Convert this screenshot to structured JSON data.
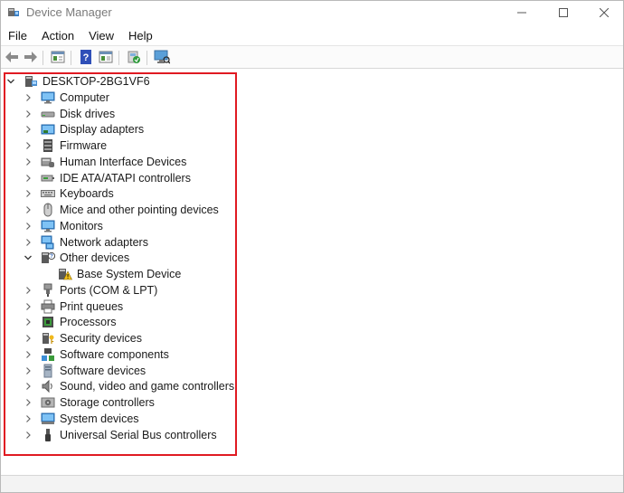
{
  "window": {
    "title": "Device Manager",
    "icon": "device-manager-icon",
    "controls": [
      "minimize-icon",
      "maximize-icon",
      "close-icon"
    ]
  },
  "menubar": {
    "items": [
      "File",
      "Action",
      "View",
      "Help"
    ]
  },
  "toolbar": {
    "buttons": [
      "back-arrow-icon",
      "forward-arrow-icon",
      "properties-icon",
      "help-icon",
      "show-hide-icon",
      "update-driver-icon",
      "scan-hardware-icon"
    ]
  },
  "tree": {
    "root": {
      "label": "DESKTOP-2BG1VF6",
      "expanded": true,
      "icon": "computer-tower-icon"
    },
    "categories": [
      {
        "label": "Computer",
        "icon": "monitor-icon",
        "expanded": false
      },
      {
        "label": "Disk drives",
        "icon": "disk-drive-icon",
        "expanded": false
      },
      {
        "label": "Display adapters",
        "icon": "display-adapter-icon",
        "expanded": false
      },
      {
        "label": "Firmware",
        "icon": "firmware-icon",
        "expanded": false
      },
      {
        "label": "Human Interface Devices",
        "icon": "hid-icon",
        "expanded": false
      },
      {
        "label": "IDE ATA/ATAPI controllers",
        "icon": "ide-controller-icon",
        "expanded": false
      },
      {
        "label": "Keyboards",
        "icon": "keyboard-icon",
        "expanded": false
      },
      {
        "label": "Mice and other pointing devices",
        "icon": "mouse-icon",
        "expanded": false
      },
      {
        "label": "Monitors",
        "icon": "monitor-icon",
        "expanded": false
      },
      {
        "label": "Network adapters",
        "icon": "network-adapter-icon",
        "expanded": false
      },
      {
        "label": "Other devices",
        "icon": "unknown-device-icon",
        "expanded": true,
        "children": [
          {
            "label": "Base System Device",
            "icon": "warning-device-icon"
          }
        ]
      },
      {
        "label": "Ports (COM & LPT)",
        "icon": "port-icon",
        "expanded": false
      },
      {
        "label": "Print queues",
        "icon": "printer-icon",
        "expanded": false
      },
      {
        "label": "Processors",
        "icon": "processor-icon",
        "expanded": false
      },
      {
        "label": "Security devices",
        "icon": "security-device-icon",
        "expanded": false
      },
      {
        "label": "Software components",
        "icon": "software-component-icon",
        "expanded": false
      },
      {
        "label": "Software devices",
        "icon": "software-device-icon",
        "expanded": false
      },
      {
        "label": "Sound, video and game controllers",
        "icon": "speaker-icon",
        "expanded": false
      },
      {
        "label": "Storage controllers",
        "icon": "storage-controller-icon",
        "expanded": false
      },
      {
        "label": "System devices",
        "icon": "system-device-icon",
        "expanded": false
      },
      {
        "label": "Universal Serial Bus controllers",
        "icon": "usb-icon",
        "expanded": false
      }
    ]
  },
  "colors": {
    "highlight": "#e01a22",
    "accent": "#2b78d6"
  }
}
